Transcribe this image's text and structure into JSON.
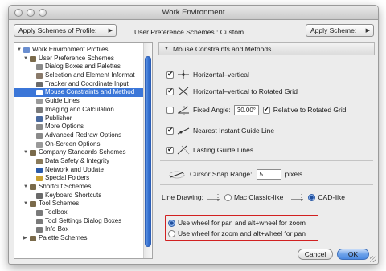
{
  "window": {
    "title": "Work Environment"
  },
  "toolbar": {
    "apply_profile_label": "Apply Schemes of Profile:",
    "scheme_label": "User Preference Schemes : Custom",
    "apply_scheme_label": "Apply Scheme:"
  },
  "tree": [
    {
      "label": "Work Environment Profiles",
      "level": 0,
      "disc": "▼",
      "icon_color": "#6a8ed0"
    },
    {
      "label": "User Preference Schemes",
      "level": 1,
      "disc": "▼",
      "icon_color": "#7a6a4a"
    },
    {
      "label": "Dialog Boxes and Palettes",
      "level": 2,
      "icon_color": "#8a8a8a"
    },
    {
      "label": "Selection and Element Informat",
      "level": 2,
      "icon_color": "#8a7a6a"
    },
    {
      "label": "Tracker and Coordinate Input",
      "level": 2,
      "icon_color": "#6a6a6a"
    },
    {
      "label": "Mouse Constraints and Method",
      "level": 2,
      "icon_color": "#ffffff",
      "selected": true
    },
    {
      "label": "Guide Lines",
      "level": 2,
      "icon_color": "#9a9a9a"
    },
    {
      "label": "Imaging and Calculation",
      "level": 2,
      "icon_color": "#7a7a7a"
    },
    {
      "label": "Publisher",
      "level": 2,
      "icon_color": "#4a6aa0"
    },
    {
      "label": "More Options",
      "level": 2,
      "icon_color": "#8a8a8a"
    },
    {
      "label": "Advanced Redraw Options",
      "level": 2,
      "icon_color": "#8a8a8a"
    },
    {
      "label": "On-Screen Options",
      "level": 2,
      "icon_color": "#9a9a9a"
    },
    {
      "label": "Company Standards Schemes",
      "level": 1,
      "disc": "▼",
      "icon_color": "#7a6a4a"
    },
    {
      "label": "Data Safety & Integrity",
      "level": 2,
      "icon_color": "#8a7a5a"
    },
    {
      "label": "Network and Update",
      "level": 2,
      "icon_color": "#2a5aa8"
    },
    {
      "label": "Special Folders",
      "level": 2,
      "icon_color": "#c9a030"
    },
    {
      "label": "Shortcut Schemes",
      "level": 1,
      "disc": "▼",
      "icon_color": "#7a6a4a"
    },
    {
      "label": "Keyboard Shortcuts",
      "level": 2,
      "icon_color": "#6a6a6a"
    },
    {
      "label": "Tool Schemes",
      "level": 1,
      "disc": "▼",
      "icon_color": "#7a6a4a"
    },
    {
      "label": "Toolbox",
      "level": 2,
      "icon_color": "#7a7a7a"
    },
    {
      "label": "Tool Settings Dialog Boxes",
      "level": 2,
      "icon_color": "#7a7a7a"
    },
    {
      "label": "Info Box",
      "level": 2,
      "icon_color": "#7a7a7a"
    },
    {
      "label": "Palette Schemes",
      "level": 1,
      "disc": "▶",
      "icon_color": "#7a6a4a"
    }
  ],
  "panel": {
    "header": "Mouse Constraints and Methods",
    "horizontal_vertical": {
      "label": "Horizontal–vertical",
      "checked": true
    },
    "rotated_grid": {
      "label": "Horizontal–vertical to Rotated Grid",
      "checked": true
    },
    "fixed_angle": {
      "label": "Fixed Angle:",
      "checked": false,
      "value": "30.00°"
    },
    "relative_rotated": {
      "label": "Relative to Rotated Grid",
      "checked": true
    },
    "nearest_guide": {
      "label": "Nearest Instant Guide Line",
      "checked": true
    },
    "lasting_guide": {
      "label": "Lasting Guide Lines",
      "checked": true
    },
    "snap_range": {
      "label": "Cursor Snap Range:",
      "value": "5",
      "unit": "pixels"
    },
    "line_drawing": {
      "label": "Line Drawing:",
      "mac_classic": "Mac Classic-like",
      "cad_like": "CAD-like",
      "selected": "cad_like"
    },
    "wheel_pan": {
      "label": "Use wheel for pan and alt+wheel for zoom",
      "selected": true
    },
    "wheel_zoom": {
      "label": "Use wheel for zoom and alt+wheel for pan",
      "selected": false
    }
  },
  "buttons": {
    "cancel": "Cancel",
    "ok": "OK"
  }
}
